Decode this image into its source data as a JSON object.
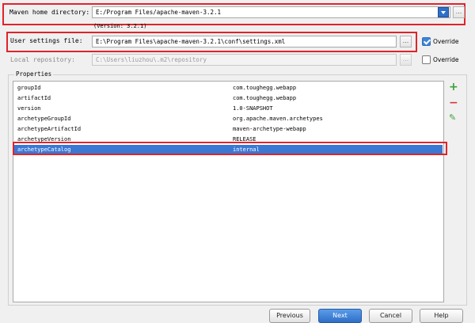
{
  "maven_home": {
    "label": "Maven home directory:",
    "value": "E:/Program Files/apache-maven-3.2.1",
    "version_note": "(Version: 3.2.1)",
    "browse": "..."
  },
  "user_settings": {
    "label": "User settings file:",
    "value": "E:\\Program Files\\apache-maven-3.2.1\\conf\\settings.xml",
    "browse": "...",
    "override_label": "Override",
    "override_checked": true
  },
  "local_repo": {
    "label": "Local repository:",
    "value": "C:\\Users\\liuzhou\\.m2\\repository",
    "browse": "...",
    "override_label": "Override",
    "override_checked": false
  },
  "properties": {
    "title": "Properties",
    "rows": [
      {
        "key": "groupId",
        "value": "com.toughegg.webapp"
      },
      {
        "key": "artifactId",
        "value": "com.toughegg.webapp"
      },
      {
        "key": "version",
        "value": "1.0-SNAPSHOT"
      },
      {
        "key": "archetypeGroupId",
        "value": "org.apache.maven.archetypes"
      },
      {
        "key": "archetypeArtifactId",
        "value": "maven-archetype-webapp"
      },
      {
        "key": "archetypeVersion",
        "value": "RELEASE"
      },
      {
        "key": "archetypeCatalog",
        "value": "internal"
      }
    ],
    "add_icon": "+",
    "remove_icon": "−",
    "edit_icon": "✎"
  },
  "colors": {
    "highlight": "#e0242a",
    "selection": "#3b78d4",
    "add": "#3aa13a",
    "remove": "#d23a3a",
    "edit": "#3aa13a"
  },
  "footer": {
    "previous": "Previous",
    "next": "Next",
    "cancel": "Cancel",
    "help": "Help"
  }
}
